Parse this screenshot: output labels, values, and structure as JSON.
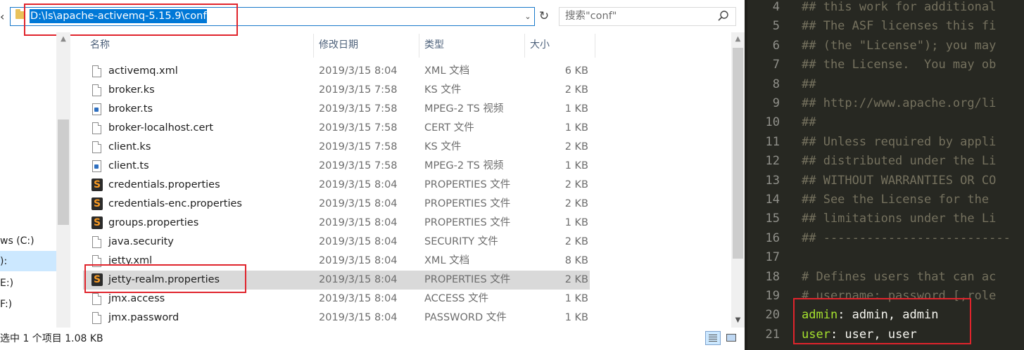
{
  "explorer": {
    "address": "D:\\ls\\apache-activemq-5.15.9\\conf",
    "search_placeholder": "搜索\"conf\"",
    "nav_items": [
      "ws (C:)",
      "):",
      "E:)",
      "F:)"
    ],
    "columns": {
      "name": "名称",
      "date": "修改日期",
      "type": "类型",
      "size": "大小"
    },
    "files": [
      {
        "name": "activemq.xml",
        "date": "2019/3/15 8:04",
        "type": "XML 文档",
        "size": "6 KB",
        "icon": "document-icon"
      },
      {
        "name": "broker.ks",
        "date": "2019/3/15 7:58",
        "type": "KS 文件",
        "size": "2 KB",
        "icon": "document-icon"
      },
      {
        "name": "broker.ts",
        "date": "2019/3/15 7:58",
        "type": "MPEG-2 TS 视频",
        "size": "1 KB",
        "icon": "media-file-icon"
      },
      {
        "name": "broker-localhost.cert",
        "date": "2019/3/15 7:58",
        "type": "CERT 文件",
        "size": "1 KB",
        "icon": "document-icon"
      },
      {
        "name": "client.ks",
        "date": "2019/3/15 7:58",
        "type": "KS 文件",
        "size": "2 KB",
        "icon": "document-icon"
      },
      {
        "name": "client.ts",
        "date": "2019/3/15 7:58",
        "type": "MPEG-2 TS 视频",
        "size": "1 KB",
        "icon": "media-file-icon"
      },
      {
        "name": "credentials.properties",
        "date": "2019/3/15 8:04",
        "type": "PROPERTIES 文件",
        "size": "2 KB",
        "icon": "sublime-text-icon"
      },
      {
        "name": "credentials-enc.properties",
        "date": "2019/3/15 8:04",
        "type": "PROPERTIES 文件",
        "size": "2 KB",
        "icon": "sublime-text-icon"
      },
      {
        "name": "groups.properties",
        "date": "2019/3/15 8:04",
        "type": "PROPERTIES 文件",
        "size": "1 KB",
        "icon": "sublime-text-icon"
      },
      {
        "name": "java.security",
        "date": "2019/3/15 8:04",
        "type": "SECURITY 文件",
        "size": "2 KB",
        "icon": "document-icon"
      },
      {
        "name": "jetty.xml",
        "date": "2019/3/15 8:04",
        "type": "XML 文档",
        "size": "8 KB",
        "icon": "document-icon"
      },
      {
        "name": "jetty-realm.properties",
        "date": "2019/3/15 8:04",
        "type": "PROPERTIES 文件",
        "size": "2 KB",
        "icon": "sublime-text-icon",
        "selected": true
      },
      {
        "name": "jmx.access",
        "date": "2019/3/15 8:04",
        "type": "ACCESS 文件",
        "size": "1 KB",
        "icon": "document-icon"
      },
      {
        "name": "jmx.password",
        "date": "2019/3/15 8:04",
        "type": "PASSWORD 文件",
        "size": "1 KB",
        "icon": "document-icon"
      }
    ],
    "status": "选中 1 个项目  1.08 KB"
  },
  "editor": {
    "lines": [
      {
        "num": "4",
        "text": "## this work for additional"
      },
      {
        "num": "5",
        "text": "## The ASF licenses this fi"
      },
      {
        "num": "6",
        "text": "## (the \"License\"); you may"
      },
      {
        "num": "7",
        "text": "## the License.  You may ob"
      },
      {
        "num": "8",
        "text": "##"
      },
      {
        "num": "9",
        "text": "## http://www.apache.org/li"
      },
      {
        "num": "10",
        "text": "##"
      },
      {
        "num": "11",
        "text": "## Unless required by appli"
      },
      {
        "num": "12",
        "text": "## distributed under the Li"
      },
      {
        "num": "13",
        "text": "## WITHOUT WARRANTIES OR CO"
      },
      {
        "num": "14",
        "text": "## See the License for the"
      },
      {
        "num": "15",
        "text": "## limitations under the Li"
      },
      {
        "num": "16",
        "text": "## --------------------------"
      },
      {
        "num": "17",
        "text": ""
      },
      {
        "num": "18",
        "text": "# Defines users that can ac"
      },
      {
        "num": "19",
        "text": "# username: password [,role"
      },
      {
        "num": "20",
        "key": "admin",
        "value": ": admin, admin"
      },
      {
        "num": "21",
        "key": "user",
        "value": ": user, user"
      }
    ]
  },
  "colors": {
    "highlight_red": "#e0242c",
    "editor_bg": "#272822",
    "comment": "#75715e",
    "key": "#a6e22e"
  }
}
